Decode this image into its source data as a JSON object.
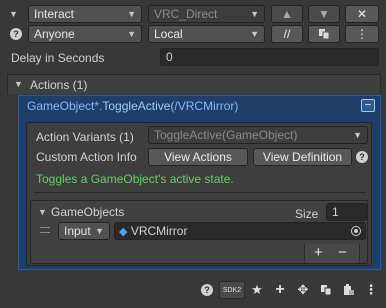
{
  "header": {
    "event_type": "Interact",
    "target_component": "VRC_Direct",
    "up_label": "▲",
    "down_label": "▼",
    "close_label": "✕",
    "broadcast_type": "Anyone",
    "local_label": "Local",
    "comment_label": "//",
    "menu_label": "⋮"
  },
  "delay": {
    "label": "Delay in Seconds",
    "value": "0"
  },
  "actions": {
    "title": "Actions (1)",
    "entry_prefix": "GameObject*.",
    "entry_method": "ToggleActive",
    "entry_arg": "(/VRCMirror)",
    "remove_label": "−",
    "variants_label": "Action Variants (1)",
    "variant_value": "ToggleActive(GameObject)",
    "custom_info_label": "Custom Action Info",
    "view_actions_label": "View Actions",
    "view_definition_label": "View Definition",
    "description": "Toggles a GameObject's active state.",
    "gameobjects_label": "GameObjects",
    "size_label": "Size",
    "size_value": "1",
    "item_mode": "Input",
    "item_value": "VRCMirror",
    "add_label": "+",
    "minus_label": "−"
  },
  "bottom_toolbar": {
    "sdk_label": "SDK2",
    "star_label": "★",
    "plus_label": "+",
    "move_label": "✥"
  },
  "colors": {
    "accent_green": "#5fd35f",
    "highlight_blue": "#1f3f6a",
    "text_blue": "#86b8ff"
  }
}
